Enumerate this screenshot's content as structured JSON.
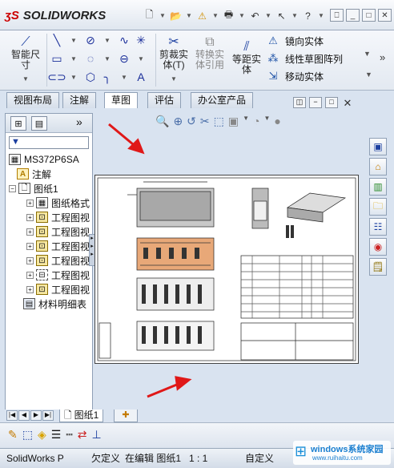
{
  "app": {
    "logo": "SOLIDWORKS"
  },
  "window_buttons": [
    "⎕",
    "_",
    "□",
    "✕"
  ],
  "ribbon": {
    "smart_dimension": "智能尺寸",
    "smart_dimension_l1": "智能尺",
    "smart_dimension_l2": "寸",
    "trim": "剪裁实体",
    "trim_l1": "剪裁实",
    "trim_l2": "体(T)",
    "convert": "转换实体引用",
    "convert_l1": "转换实",
    "convert_l2": "体引用",
    "offset": "等距实体",
    "offset_l1": "等距实",
    "offset_l2": "体",
    "mirror": "镜向实体",
    "linear_pattern": "线性草图阵列",
    "move": "移动实体"
  },
  "tabs": [
    "视图布局",
    "注解",
    "草图",
    "评估",
    "办公室产品"
  ],
  "active_tab": "草图",
  "feature_tree": {
    "root": "MS372P6SA",
    "annotations": "注解",
    "sheet": "图纸1",
    "items": [
      "图纸格式",
      "工程图视",
      "工程图视",
      "工程图视",
      "工程图视",
      "工程图视",
      "工程图视"
    ],
    "bom": "材料明细表"
  },
  "bottom_tabs": [
    "图纸1"
  ],
  "status": {
    "app_name": "SolidWorks P",
    "underdefined": "欠定义",
    "editing": "在编辑 图纸1",
    "scale": "1 : 1",
    "custom": "自定义"
  },
  "watermark": {
    "line1": "windows系统家园",
    "line2": "www.ruihaitu.com"
  },
  "colors": {
    "accent": "#1b3fa0",
    "arrow": "#e01818",
    "panel": "#d9e3f0"
  }
}
